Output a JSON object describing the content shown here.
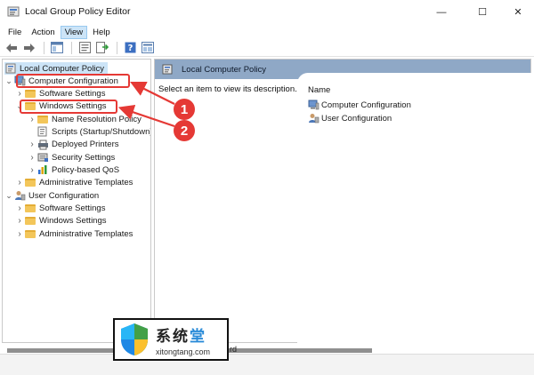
{
  "window": {
    "title": "Local Group Policy Editor",
    "controls": {
      "minimize": "—",
      "maximize": "☐",
      "close": "✕"
    }
  },
  "menu": [
    "File",
    "Action",
    "View",
    "Help"
  ],
  "menu_active": "View",
  "toolbar": {
    "buttons": [
      "back-arrow-icon",
      "forward-arrow-icon",
      "show-hide-tree-icon",
      "properties-icon",
      "export-list-icon",
      "help-icon",
      "filter-icon"
    ]
  },
  "tree": {
    "root": "Local Computer Policy",
    "items": [
      {
        "label": "Computer Configuration",
        "level": 1,
        "twisty": "v",
        "icon": "computer-icon"
      },
      {
        "label": "Software Settings",
        "level": 2,
        "twisty": ">",
        "icon": "folder-icon"
      },
      {
        "label": "Windows Settings",
        "level": 2,
        "twisty": "v",
        "icon": "folder-icon"
      },
      {
        "label": "Name Resolution Policy",
        "level": 3,
        "twisty": ">",
        "icon": "folder-icon"
      },
      {
        "label": "Scripts (Startup/Shutdown)",
        "level": 3,
        "twisty": "",
        "icon": "scripts-icon"
      },
      {
        "label": "Deployed Printers",
        "level": 3,
        "twisty": ">",
        "icon": "printer-icon"
      },
      {
        "label": "Security Settings",
        "level": 3,
        "twisty": ">",
        "icon": "security-icon"
      },
      {
        "label": "Policy-based QoS",
        "level": 3,
        "twisty": ">",
        "icon": "chart-icon"
      },
      {
        "label": "Administrative Templates",
        "level": 2,
        "twisty": ">",
        "icon": "folder-icon"
      },
      {
        "label": "User Configuration",
        "level": 1,
        "twisty": "v",
        "icon": "user-icon"
      },
      {
        "label": "Software Settings",
        "level": 2,
        "twisty": ">",
        "icon": "folder-icon"
      },
      {
        "label": "Windows Settings",
        "level": 2,
        "twisty": ">",
        "icon": "folder-icon"
      },
      {
        "label": "Administrative Templates",
        "level": 2,
        "twisty": ">",
        "icon": "folder-icon"
      }
    ]
  },
  "right_pane": {
    "header": "Local Computer Policy",
    "description": "Select an item to view its description.",
    "column_name": "Name",
    "rows": [
      {
        "label": "Computer Configuration",
        "icon": "computer-icon"
      },
      {
        "label": "User Configuration",
        "icon": "user-icon"
      }
    ]
  },
  "tab_label": "rd",
  "annotations": {
    "badge_1": "1",
    "badge_2": "2",
    "color": "#e53935"
  },
  "watermark": {
    "cn": "系统",
    "cn_accent": "堂",
    "url": "xitongtang.com"
  },
  "colors": {
    "selection": "#cce4f7",
    "header": "#8fa8c6",
    "folder": "#f3c65a"
  }
}
